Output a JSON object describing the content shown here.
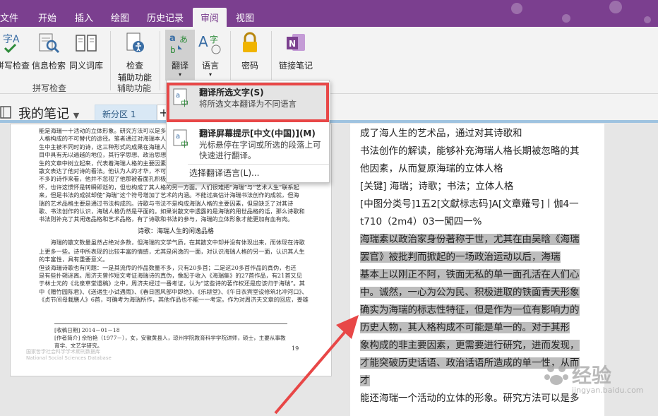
{
  "tabs": [
    {
      "label": "文件",
      "active": false
    },
    {
      "label": "开始",
      "active": false
    },
    {
      "label": "插入",
      "active": false
    },
    {
      "label": "绘图",
      "active": false
    },
    {
      "label": "历史记录",
      "active": false
    },
    {
      "label": "审阅",
      "active": true
    },
    {
      "label": "视图",
      "active": false
    }
  ],
  "ribbon": {
    "spell_check": "拼写检查",
    "research": "信息检索",
    "thesaurus": "同义词库",
    "group_spelling": "拼写检查",
    "accessibility_line1": "检查",
    "accessibility_line2": "辅助功能",
    "group_accessibility": "辅助功能",
    "translate": "翻译",
    "language": "语言",
    "password": "密码",
    "linked_notes": "链接笔记"
  },
  "translate_menu": {
    "item1_title": "翻译所选文字(S)",
    "item1_desc": "将所选文本翻译为不同语言",
    "item2_title": "翻译屏幕提示[中文(中国)](M)",
    "item2_desc": "光标悬停在字词或所选的段落上可快速进行翻译。",
    "choose_language": "选择翻译语言(L)..."
  },
  "notebook": {
    "name": "我的笔记",
    "section": "新分区 1",
    "add_section": "+"
  },
  "scan": {
    "lines_top": [
      "能是海瑞一十活动的立体形象。研究方法可以是多",
      "人格构成的不可替代的途径。笔者通过对海瑞本人",
      "生中主被不同时的诗，这三种形式的成果在海瑞人",
      "目中具有无以遍越的地位，其行学思想、政治思想",
      "生的文章中树立起来，代表着海瑞人格的主要因素",
      "散文表达了他对诗的看法。他认为人的才华，不可",
      "不多的诗作来看，他并不忽视了他那被看面孔积极",
      "怀，也许这惯怀是转瞬即逝的，但也构成了其人格的另一方面。人们很难把“海瑞”与“艺术人生”联系起",
      "来，但是书法的成就却使“海瑞”这个符号增加了艺术的内涵。不能过高估计海瑞书法创作的成就，但海",
      "瑞的艺术品格主要是通过书法构成的。诗歌与书法不是构成海瑞人格的主要因素，但是缺乏了对其诗",
      "歌、书法创作的认识，海瑞人格仍然是平面的。如果说散文中透露的是海瑞的用世品格的话，那么诗歌和",
      "书法则补充了其闲逸品格和艺术品格，有了诗歌和书法的参与，海瑞的立体形象才能更加有血有肉。"
    ],
    "heading": "诗歌：海瑞人生的闲逸品格",
    "lines_bottom": [
      "海瑞的散文数量虽然占绝对多数，但海瑞的文学气质，在其散文中却并没有体现出来，而体现在诗歌",
      "上更多一些。诗中所表现的比较丰富的情感，尤其是闲逸的一面，对认识海瑞人格的另一面，认识其人生",
      "的丰富性，具有重要意义。",
      "但谈海瑞诗歌也有问题：一是其流传的作品数量不多，只有20多首；二是这20多首作品的真伪，也还",
      "是有些扑朔迷离。周济夫曾作短文考证海瑞诗的真伪，像起于收入《海瑞集》的27首作品，有21首又见",
      "于林士元的《北泉草堂遗稿》之中，周济夫经过一番考证，认为“这些诗的著作权还是应该归于海瑞”。其",
      "中《赠竹园陈君》、《送诸生小试遇雨》、《春日困风部中即绝》、《乐耕堂》、《午日衣宾堂设修筑北冲河口》、",
      "《贞节间母栽膳人》6首，可确考为海瑞所作，其他作品也不能一一考定。作为对周济夫文章的回应，姜雄"
    ],
    "meta_line1": "[收稿日期] 2014－01－18",
    "meta_line2": "[作者简介] 佘怡艳（1977－），女，安徽黄县人，琼州学院教育科学学院讲师，硕士，主要从事教育学、文艺学研究。",
    "page_number": "19",
    "watermark_line1": "国家哲学社会科学学术期刊数据库",
    "watermark_line2": "National Social Sciences Database"
  },
  "text_lines": [
    {
      "text": "成了海人生的艺术品，通过对其诗歌和",
      "hl": false
    },
    {
      "text": "书法创作的解读，能够补充海瑞人格长期被忽略的其",
      "hl": false
    },
    {
      "text": "他因素，从而复原海瑞的立体人格",
      "hl": false
    },
    {
      "text": "[关键] 海瑞；诗歌；书法；立体人格",
      "hl": false
    },
    {
      "text": "[中图分类号]1五2[文獻标志码]A[文章薙号]丨伽4一",
      "hl": false
    },
    {
      "text": "t710（2m4）03一闖四一%",
      "hl": false
    },
    {
      "text": "海瑞素以政治家身份著称于世，尤其在由吴晗《海瑞",
      "hl": true
    },
    {
      "text": "罢官》被批判而掀起的一场政治运动以后，海瑞",
      "hl": true
    },
    {
      "text": "基本上以刚正不阿，铁面无私的单一面孔活在人们心",
      "hl": true
    },
    {
      "text": "中。诚然，一心为公为民、积极进取的铁面青天形象",
      "hl": true
    },
    {
      "text": "确实为海瑞的标志性特征，但是作为一位有影响力的",
      "hl": true
    },
    {
      "text": "历史人物，其人格构成不可能是单一的。对于其形",
      "hl": true
    },
    {
      "text": "象构成的非主要因素，更需要进行研究，进而发现，",
      "hl": true
    },
    {
      "text": "才能突破历史话语、政治话语所造成的单一性，从而",
      "hl": true
    },
    {
      "text": "才",
      "hl": true
    },
    {
      "text": "能还海瑞一个活动的立体的形象。研究方法可以是多",
      "hl": false
    }
  ],
  "brand_watermark": {
    "line1": "经验",
    "line2": "jingyan.baidu.com"
  },
  "colors": {
    "tab_bar": "#7b3f8f",
    "accent_blue": "#9fc3e0",
    "highlight": "#bdbdbd",
    "annotation_red": "#e84747"
  }
}
